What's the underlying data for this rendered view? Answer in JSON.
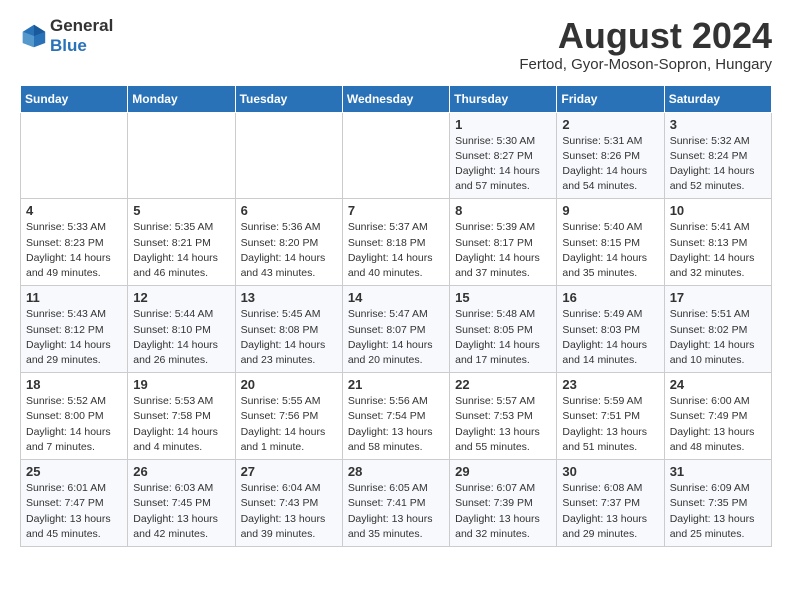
{
  "header": {
    "logo_general": "General",
    "logo_blue": "Blue",
    "month_title": "August 2024",
    "location": "Fertod, Gyor-Moson-Sopron, Hungary"
  },
  "days_of_week": [
    "Sunday",
    "Monday",
    "Tuesday",
    "Wednesday",
    "Thursday",
    "Friday",
    "Saturday"
  ],
  "weeks": [
    [
      {
        "day": "",
        "details": ""
      },
      {
        "day": "",
        "details": ""
      },
      {
        "day": "",
        "details": ""
      },
      {
        "day": "",
        "details": ""
      },
      {
        "day": "1",
        "details": "Sunrise: 5:30 AM\nSunset: 8:27 PM\nDaylight: 14 hours\nand 57 minutes."
      },
      {
        "day": "2",
        "details": "Sunrise: 5:31 AM\nSunset: 8:26 PM\nDaylight: 14 hours\nand 54 minutes."
      },
      {
        "day": "3",
        "details": "Sunrise: 5:32 AM\nSunset: 8:24 PM\nDaylight: 14 hours\nand 52 minutes."
      }
    ],
    [
      {
        "day": "4",
        "details": "Sunrise: 5:33 AM\nSunset: 8:23 PM\nDaylight: 14 hours\nand 49 minutes."
      },
      {
        "day": "5",
        "details": "Sunrise: 5:35 AM\nSunset: 8:21 PM\nDaylight: 14 hours\nand 46 minutes."
      },
      {
        "day": "6",
        "details": "Sunrise: 5:36 AM\nSunset: 8:20 PM\nDaylight: 14 hours\nand 43 minutes."
      },
      {
        "day": "7",
        "details": "Sunrise: 5:37 AM\nSunset: 8:18 PM\nDaylight: 14 hours\nand 40 minutes."
      },
      {
        "day": "8",
        "details": "Sunrise: 5:39 AM\nSunset: 8:17 PM\nDaylight: 14 hours\nand 37 minutes."
      },
      {
        "day": "9",
        "details": "Sunrise: 5:40 AM\nSunset: 8:15 PM\nDaylight: 14 hours\nand 35 minutes."
      },
      {
        "day": "10",
        "details": "Sunrise: 5:41 AM\nSunset: 8:13 PM\nDaylight: 14 hours\nand 32 minutes."
      }
    ],
    [
      {
        "day": "11",
        "details": "Sunrise: 5:43 AM\nSunset: 8:12 PM\nDaylight: 14 hours\nand 29 minutes."
      },
      {
        "day": "12",
        "details": "Sunrise: 5:44 AM\nSunset: 8:10 PM\nDaylight: 14 hours\nand 26 minutes."
      },
      {
        "day": "13",
        "details": "Sunrise: 5:45 AM\nSunset: 8:08 PM\nDaylight: 14 hours\nand 23 minutes."
      },
      {
        "day": "14",
        "details": "Sunrise: 5:47 AM\nSunset: 8:07 PM\nDaylight: 14 hours\nand 20 minutes."
      },
      {
        "day": "15",
        "details": "Sunrise: 5:48 AM\nSunset: 8:05 PM\nDaylight: 14 hours\nand 17 minutes."
      },
      {
        "day": "16",
        "details": "Sunrise: 5:49 AM\nSunset: 8:03 PM\nDaylight: 14 hours\nand 14 minutes."
      },
      {
        "day": "17",
        "details": "Sunrise: 5:51 AM\nSunset: 8:02 PM\nDaylight: 14 hours\nand 10 minutes."
      }
    ],
    [
      {
        "day": "18",
        "details": "Sunrise: 5:52 AM\nSunset: 8:00 PM\nDaylight: 14 hours\nand 7 minutes."
      },
      {
        "day": "19",
        "details": "Sunrise: 5:53 AM\nSunset: 7:58 PM\nDaylight: 14 hours\nand 4 minutes."
      },
      {
        "day": "20",
        "details": "Sunrise: 5:55 AM\nSunset: 7:56 PM\nDaylight: 14 hours\nand 1 minute."
      },
      {
        "day": "21",
        "details": "Sunrise: 5:56 AM\nSunset: 7:54 PM\nDaylight: 13 hours\nand 58 minutes."
      },
      {
        "day": "22",
        "details": "Sunrise: 5:57 AM\nSunset: 7:53 PM\nDaylight: 13 hours\nand 55 minutes."
      },
      {
        "day": "23",
        "details": "Sunrise: 5:59 AM\nSunset: 7:51 PM\nDaylight: 13 hours\nand 51 minutes."
      },
      {
        "day": "24",
        "details": "Sunrise: 6:00 AM\nSunset: 7:49 PM\nDaylight: 13 hours\nand 48 minutes."
      }
    ],
    [
      {
        "day": "25",
        "details": "Sunrise: 6:01 AM\nSunset: 7:47 PM\nDaylight: 13 hours\nand 45 minutes."
      },
      {
        "day": "26",
        "details": "Sunrise: 6:03 AM\nSunset: 7:45 PM\nDaylight: 13 hours\nand 42 minutes."
      },
      {
        "day": "27",
        "details": "Sunrise: 6:04 AM\nSunset: 7:43 PM\nDaylight: 13 hours\nand 39 minutes."
      },
      {
        "day": "28",
        "details": "Sunrise: 6:05 AM\nSunset: 7:41 PM\nDaylight: 13 hours\nand 35 minutes."
      },
      {
        "day": "29",
        "details": "Sunrise: 6:07 AM\nSunset: 7:39 PM\nDaylight: 13 hours\nand 32 minutes."
      },
      {
        "day": "30",
        "details": "Sunrise: 6:08 AM\nSunset: 7:37 PM\nDaylight: 13 hours\nand 29 minutes."
      },
      {
        "day": "31",
        "details": "Sunrise: 6:09 AM\nSunset: 7:35 PM\nDaylight: 13 hours\nand 25 minutes."
      }
    ]
  ]
}
